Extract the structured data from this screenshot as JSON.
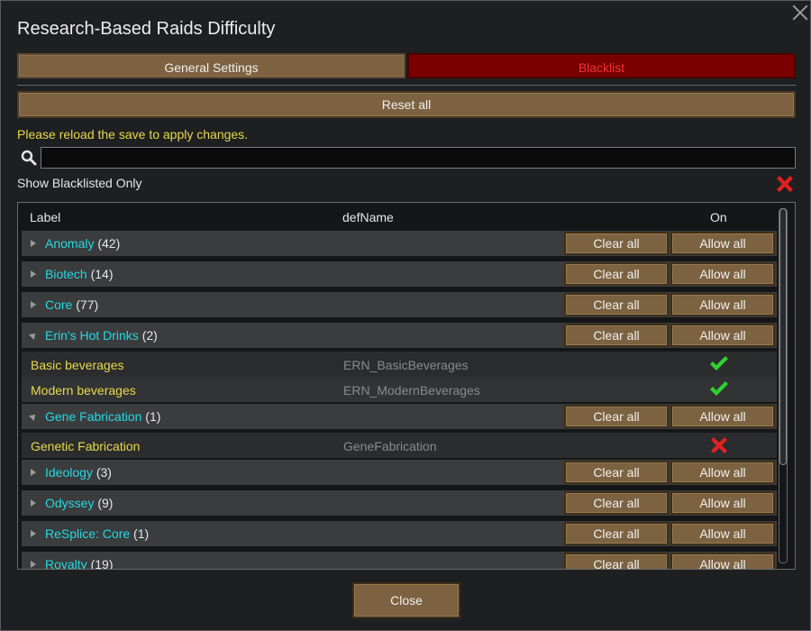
{
  "window": {
    "title": "Research-Based Raids Difficulty"
  },
  "tabs": [
    {
      "label": "General Settings",
      "active": false
    },
    {
      "label": "Blacklist",
      "active": true
    }
  ],
  "reset_all_label": "Reset all",
  "reload_message": "Please reload the save to apply changes.",
  "search": {
    "value": "",
    "placeholder": ""
  },
  "show_blacklisted": {
    "label": "Show Blacklisted Only",
    "enabled": false
  },
  "table": {
    "headers": {
      "label": "Label",
      "defname": "defName",
      "on": "On"
    },
    "clear_all_label": "Clear all",
    "allow_all_label": "Allow all",
    "groups": [
      {
        "name": "Anomaly",
        "count": "(42)",
        "expanded": false,
        "items": []
      },
      {
        "name": "Biotech",
        "count": "(14)",
        "expanded": false,
        "items": []
      },
      {
        "name": "Core",
        "count": "(77)",
        "expanded": false,
        "items": []
      },
      {
        "name": "Erin's Hot Drinks",
        "count": "(2)",
        "expanded": true,
        "items": [
          {
            "label": "Basic beverages",
            "defName": "ERN_BasicBeverages",
            "on": true
          },
          {
            "label": "Modern beverages",
            "defName": "ERN_ModernBeverages",
            "on": true
          }
        ]
      },
      {
        "name": "Gene Fabrication",
        "count": "(1)",
        "expanded": true,
        "items": [
          {
            "label": "Genetic Fabrication",
            "defName": "GeneFabrication",
            "on": false
          }
        ]
      },
      {
        "name": "Ideology",
        "count": "(3)",
        "expanded": false,
        "items": []
      },
      {
        "name": "Odyssey",
        "count": "(9)",
        "expanded": false,
        "items": []
      },
      {
        "name": "ReSplice: Core",
        "count": "(1)",
        "expanded": false,
        "items": []
      },
      {
        "name": "Royalty",
        "count": "(19)",
        "expanded": false,
        "items": []
      }
    ]
  },
  "close_label": "Close",
  "colors": {
    "group_name": "#25d9e0",
    "item_label": "#e8d94a",
    "check": "#2fd12f",
    "cross": "#e02020"
  },
  "icons": {
    "check": "check-icon",
    "cross": "cross-icon",
    "search": "search-icon",
    "close": "close-icon"
  }
}
